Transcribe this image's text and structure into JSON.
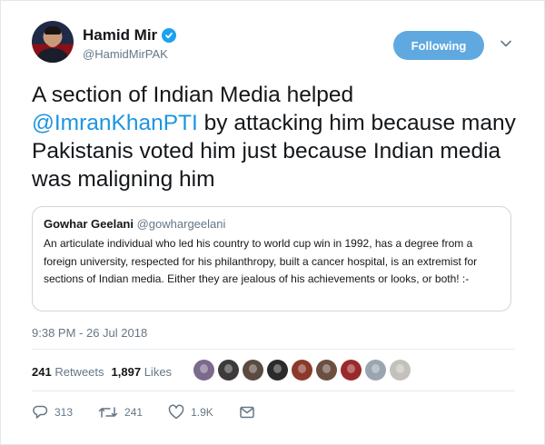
{
  "author": {
    "name": "Hamid Mir",
    "handle": "@HamidMirPAK",
    "verified": true
  },
  "follow_button": {
    "label": "Following"
  },
  "tweet": {
    "text_before": "A section of Indian Media helped ",
    "mention": "@ImranKhanPTI",
    "text_after": " by attacking him because many Pakistanis voted him just because Indian media was maligning him"
  },
  "quoted_tweet": {
    "name": "Gowhar Geelani",
    "handle": "@gowhargeelani",
    "text": "An articulate individual who led his country to world cup  win in 1992, has a degree from a foreign university, respected for his philanthropy, built a cancer hospital, is an extremist for sections of Indian media. Either they are jealous of his achievements or looks, or both! :-"
  },
  "timestamp": "9:38 PM - 26 Jul 2018",
  "stats": {
    "retweets_count": "241",
    "retweets_label": "Retweets",
    "likes_count": "1,897",
    "likes_label": "Likes"
  },
  "likers": [
    "#7b6a8c",
    "#3d3a3a",
    "#5a4a3f",
    "#2a2a2a",
    "#8a3a2a",
    "#6b5040",
    "#9a2a2a",
    "#9aa5b0",
    "#c4c0bc"
  ],
  "actions": {
    "replies": "313",
    "retweets": "241",
    "likes": "1.9K"
  },
  "colors": {
    "accent": "#1da1f2",
    "mention": "#1b95e0",
    "follow_button": "#5fa9e0",
    "secondary_text": "#657786"
  },
  "icons": [
    "verified-badge-icon",
    "chevron-down-icon",
    "reply-icon",
    "retweet-icon",
    "like-icon",
    "dm-icon"
  ]
}
